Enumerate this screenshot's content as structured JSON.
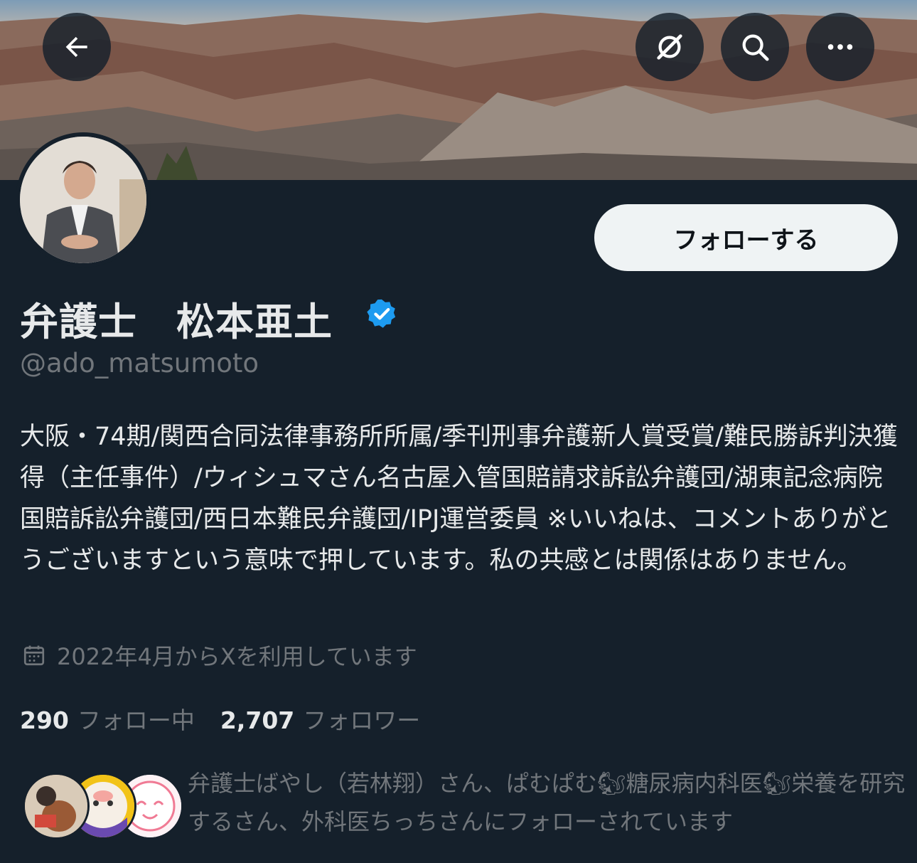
{
  "header": {
    "back_icon": "arrow-left-icon",
    "grok_icon": "grok-icon",
    "search_icon": "search-icon",
    "more_icon": "more-horizontal-icon"
  },
  "profile": {
    "follow_label": "フォローする",
    "display_name": "弁護士　松本亜土",
    "verified": true,
    "handle": "@ado_matsumoto",
    "bio": "大阪・74期/関西合同法律事務所所属/季刊刑事弁護新人賞受賞/難民勝訴判決獲得（主任事件）/ウィシュマさん名古屋入管国賠請求訴訟弁護団/湖東記念病院国賠訴訟弁護団/西日本難民弁護団/IPJ運営委員 ※いいねは、コメントありがとうございますという意味で押しています。私の共感とは関係はありません。",
    "joined": "2022年4月からXを利用しています",
    "following_count": "290",
    "following_label": "フォロー中",
    "followers_count": "2,707",
    "followers_label": "フォロワー",
    "followed_by": "弁護士ばやし（若林翔）さん、ぱむぱむ🐿糖尿病内科医🐿栄養を研究するさん、外科医ちっちさんにフォローされています"
  },
  "colors": {
    "background": "#15202b",
    "primary_text": "#e7e9ea",
    "secondary_text": "#71767b",
    "verified_blue": "#1d9bf0",
    "button_bg": "#eff3f4"
  }
}
